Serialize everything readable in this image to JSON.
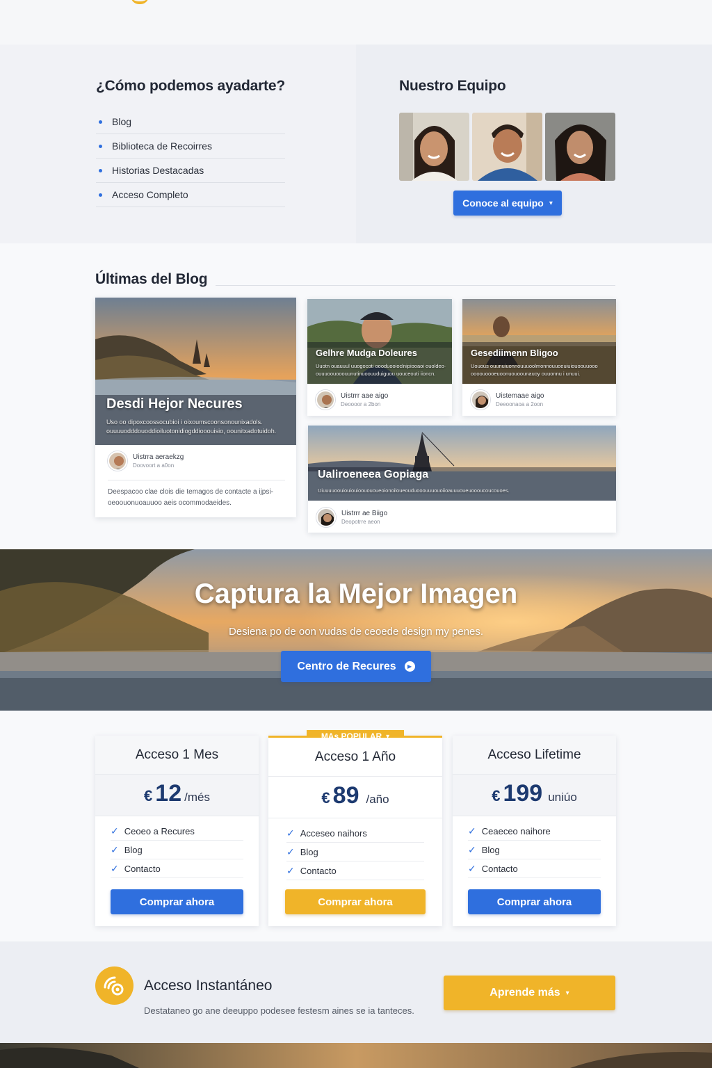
{
  "help": {
    "title": "¿Cómo podemos ayadarte?",
    "items": [
      "Blog",
      "Biblioteca de Recoirres",
      "Historias Destacadas",
      "Acceso Completo"
    ]
  },
  "team": {
    "title": "Nuestro Equipo",
    "button_label": "Conoce al equipo",
    "member_count": 3
  },
  "blog": {
    "title": "Últimas del Blog",
    "featured": {
      "heading": "Desdi Hejor Necures",
      "excerpt_line1": "Uso oo dipoxcoossocubioi i oixoumscoonsonounixadols.",
      "excerpt_line2": "ouuuuodddouoddioiluotonidiogddiooouisio, oounitxadotuidoh.",
      "author": "Uistrra aeraekzg",
      "date": "Doovoort a a0on",
      "body_line1": "Deespacoo clae clois die temagos de contacte a ijpsi-",
      "body_line2": "oeoouonuoauuoo aeis ocommodaeides."
    },
    "posts": [
      {
        "heading": "Gelhre Mudga Doleures",
        "excerpt_line1": "Uuotn ouauuul uuogocoti oooduooioclnipiooaoi ouoldeo·",
        "excerpt_line2": "ouuuoouooouunutinuoouuduiguou uouceouti iioncn.",
        "author": "Uistrrr aae aigo",
        "date": "Deoooor a 2bon"
      },
      {
        "heading": "Gesediimenn Bligoo",
        "excerpt_line1": "Uouous ouunuiuonnouuuoolmonnouuoeuiuiouoouuooo",
        "excerpt_line2": "oooouoooeuoonuouoounauoy ouuonnu i unuui.",
        "author": "Uistemaae aigo",
        "date": "Deeoonaoa a 2oon"
      },
      {
        "heading": "Ualiroeneea Gopiaga",
        "excerpt": "Uiuuuuoouiouiouioouououeoionoiloueouduooouuuouoiioauuuoueuoooucoucouoes.",
        "author": "Uistrrr ae Biigo",
        "date": "Deopotrre aeon"
      }
    ]
  },
  "hero": {
    "title": "Captura la Mejor Imagen",
    "subtitle": "Desiena po de oon vudas de ceoede design my penes.",
    "button_label": "Centro de Recures"
  },
  "pricing": {
    "plans": [
      {
        "name": "Acceso 1 Mes",
        "currency": "€",
        "price": "12",
        "period": "/més",
        "features": [
          "Ceoeo a Recures",
          "Blog",
          "Contacto"
        ],
        "button_label": "Comprar ahora",
        "featured": false
      },
      {
        "name": "Acceso 1 Año",
        "badge": "MAs POPULAR",
        "currency": "€",
        "price": "89",
        "period": "/año",
        "features": [
          "Acceseo naihors",
          "Blog",
          "Contacto"
        ],
        "button_label": "Comprar ahora",
        "featured": true
      },
      {
        "name": "Acceso Lifetime",
        "currency": "€",
        "price": "199",
        "period": "uniúo",
        "features": [
          "Ceaeceo naihore",
          "Blog",
          "Contacto"
        ],
        "button_label": "Comprar ahora",
        "featured": false
      }
    ]
  },
  "instant": {
    "title": "Acceso Instantáneo",
    "description": "Destataneo go ane deeuppo podesee festesm aines se ia tanteces.",
    "button_label": "Aprende más"
  },
  "colors": {
    "primary": "#2f6fde",
    "accent": "#f0b429",
    "price_text": "#1d3a70"
  },
  "icons": {
    "bullet": "dot-icon",
    "chevron": "chevron-down-icon",
    "play": "play-circle-icon",
    "check": "check-icon",
    "instant": "instant-access-icon"
  }
}
